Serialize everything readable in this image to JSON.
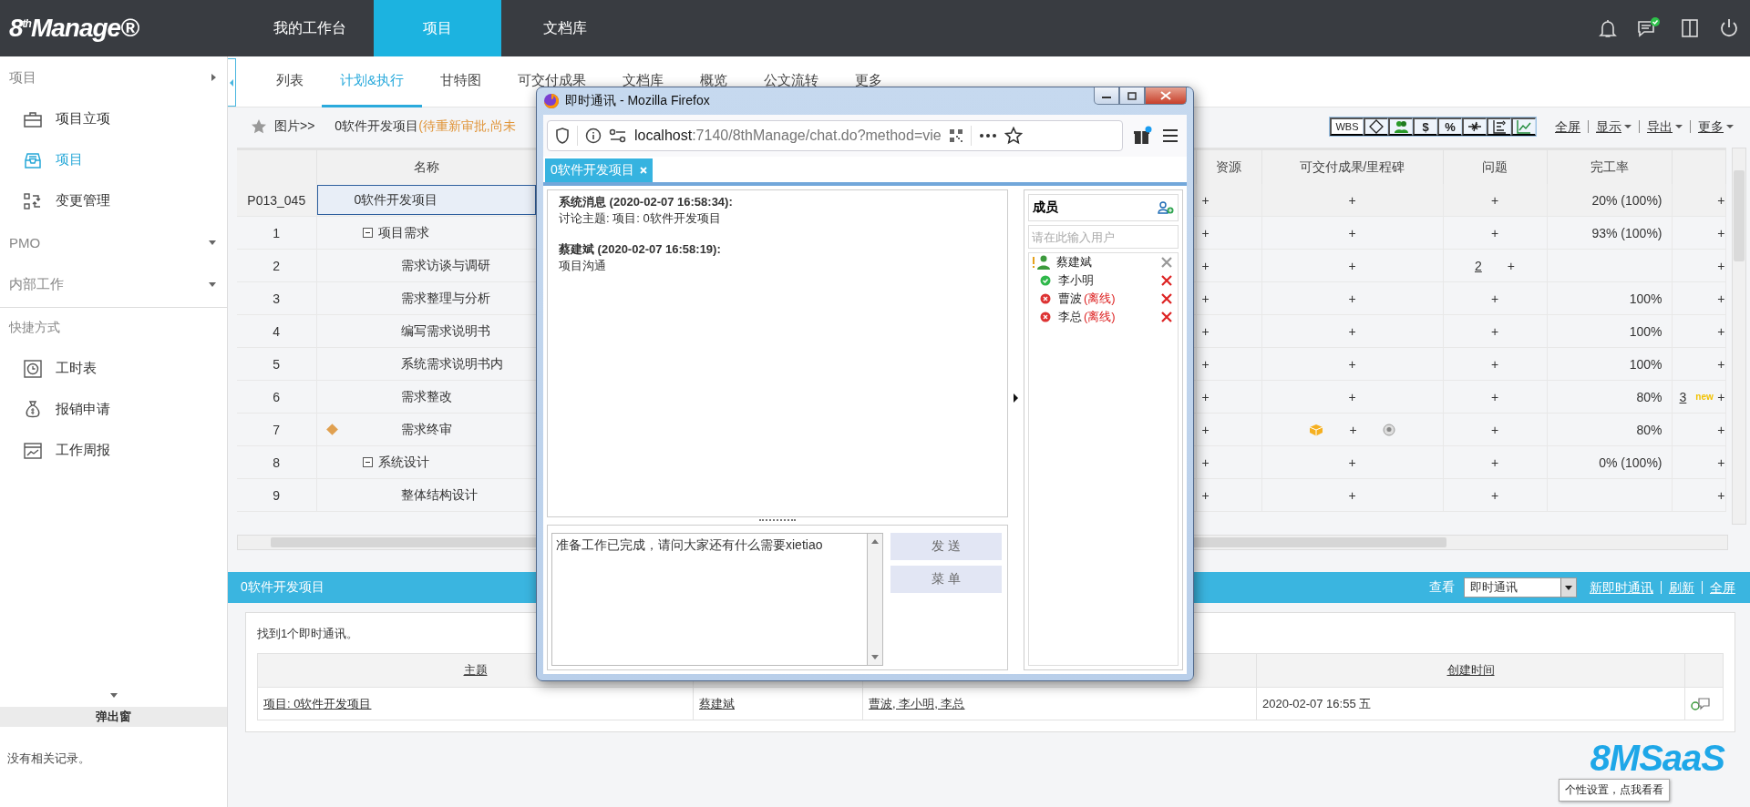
{
  "header": {
    "logo": "8$^{th}$Manage®",
    "nav": [
      {
        "label": "我的工作台",
        "selected": false
      },
      {
        "label": "项目",
        "selected": true
      },
      {
        "label": "文档库",
        "selected": false
      }
    ]
  },
  "sidebar": {
    "sections": [
      {
        "label": "项目",
        "expanded": true,
        "items": [
          {
            "label": "项目立项",
            "selected": false
          },
          {
            "label": "项目",
            "selected": true
          },
          {
            "label": "变更管理",
            "selected": false
          }
        ]
      },
      {
        "label": "PMO",
        "expanded": false
      },
      {
        "label": "内部工作",
        "expanded": false
      }
    ],
    "shortcuts": {
      "title": "快捷方式",
      "items": [
        "工时表",
        "报销申请",
        "工作周报"
      ]
    },
    "popup_panel": {
      "title": "弹出窗",
      "message": "没有相关记录。"
    }
  },
  "plan": {
    "tabs": [
      {
        "label": "列表",
        "selected": false
      },
      {
        "label": "计划&执行",
        "selected": true
      },
      {
        "label": "甘特图",
        "selected": false
      },
      {
        "label": "可交付成果",
        "selected": false
      },
      {
        "label": "文档库",
        "selected": false
      },
      {
        "label": "概览",
        "selected": false
      },
      {
        "label": "公文流转",
        "selected": false
      },
      {
        "label": "更多",
        "selected": false
      }
    ],
    "breadcrumb": {
      "link": "图片>>",
      "project": "0软件开发项目",
      "status": "(待重新审批,尚未"
    },
    "toolbar": {
      "buttons": [
        {
          "kind": "text",
          "label": "WBS",
          "selected": true
        },
        {
          "kind": "milestone",
          "selected": false
        },
        {
          "kind": "people",
          "selected": false
        },
        {
          "kind": "text",
          "label": "$",
          "selected": false
        },
        {
          "kind": "text",
          "label": "%",
          "selected": false
        },
        {
          "kind": "arrows",
          "selected": false
        },
        {
          "kind": "indent",
          "selected": false
        },
        {
          "kind": "chart",
          "selected": false
        }
      ],
      "links": [
        {
          "label": "全屏",
          "menu": false
        },
        {
          "label": "显示",
          "menu": true
        },
        {
          "label": "导出",
          "menu": true
        },
        {
          "label": "更多",
          "menu": true
        }
      ]
    },
    "table": {
      "columns": [
        "名称",
        "资源",
        "可交付成果/里程碑",
        "问题",
        "完工率"
      ],
      "rows": [
        {
          "id": "P013_045",
          "name": "0软件开发项目",
          "selected": true,
          "milestone": false,
          "resource": "+",
          "deliverable": "+",
          "deliverable_files": false,
          "issue_add": "+",
          "rate": "20% (100%)",
          "note_add": "+",
          "children": [
            {
              "id": "1",
              "name": "项目需求",
              "selected": false,
              "milestone": false,
              "expanded": true,
              "resource": "+",
              "deliverable": "+",
              "deliverable_files": false,
              "issue_add": "+",
              "rate": "93% (100%)",
              "note_add": "+",
              "children": [
                {
                  "id": "2",
                  "name": "需求访谈与调研",
                  "selected": false,
                  "milestone": false,
                  "resource": "+",
                  "deliverable": "+",
                  "deliverable_files": false,
                  "issues": "2",
                  "issue_add": "+",
                  "note_add": "+"
                },
                {
                  "id": "3",
                  "name": "需求整理与分析",
                  "selected": false,
                  "milestone": false,
                  "resource": "+",
                  "deliverable": "+",
                  "deliverable_files": false,
                  "issue_add": "+",
                  "rate": "100%",
                  "note_add": "+"
                },
                {
                  "id": "4",
                  "name": "编写需求说明书",
                  "selected": false,
                  "milestone": false,
                  "resource": "+",
                  "deliverable": "+",
                  "deliverable_files": false,
                  "issue_add": "+",
                  "rate": "100%",
                  "note_add": "+"
                },
                {
                  "id": "5",
                  "name": "系统需求说明书内",
                  "selected": false,
                  "milestone": false,
                  "resource": "+",
                  "deliverable": "+",
                  "deliverable_files": false,
                  "issue_add": "+",
                  "rate": "100%",
                  "note_add": "+"
                },
                {
                  "id": "6",
                  "name": "需求整改",
                  "selected": false,
                  "milestone": false,
                  "resource": "+",
                  "deliverable": "+",
                  "deliverable_files": false,
                  "issue_add": "+",
                  "rate": "80%",
                  "note_count": "3",
                  "note_badge": "new",
                  "note_add": "+"
                },
                {
                  "id": "7",
                  "name": "需求终审",
                  "selected": false,
                  "milestone": true,
                  "resource": "+",
                  "deliverable": "+",
                  "deliverable_files": true,
                  "issue_add": "+",
                  "rate": "80%",
                  "note_add": "+"
                }
              ]
            },
            {
              "id": "8",
              "name": "系统设计",
              "selected": false,
              "milestone": false,
              "expanded": true,
              "resource": "+",
              "deliverable": "+",
              "deliverable_files": false,
              "issue_add": "+",
              "rate": "0% (100%)",
              "note_add": "+",
              "children": [
                {
                  "id": "9",
                  "name": "整体结构设计",
                  "selected": false,
                  "milestone": false,
                  "resource": "+",
                  "deliverable": "+",
                  "deliverable_files": false,
                  "issue_add": "+",
                  "note_add": "+"
                }
              ]
            }
          ]
        }
      ]
    }
  },
  "chat_list": {
    "title": "0软件开发项目",
    "view_label": "查看",
    "view_value": "即时通讯",
    "links": [
      "新即时通讯",
      "刷新",
      "全屏"
    ],
    "summary": "找到1个即时通讯。",
    "columns": [
      {
        "label": "主题"
      },
      {},
      {},
      {
        "label": "创建时间"
      },
      {}
    ],
    "rows": [
      {
        "subject": "项目: 0软件开发项目",
        "creator": "蔡建斌",
        "members": "曹波, 李小明, 李总",
        "created": "2020-02-07 16:55 五"
      }
    ]
  },
  "popup": {
    "title": "即时通讯 - Mozilla Firefox",
    "url_host": "localhost",
    "url_path": ":7140/8thManage/chat.do?method=vie",
    "chat_tab": "0软件开发项目",
    "messages": [
      {
        "sender": "系统消息 (2020-02-07 16:58:34):",
        "text": "讨论主题: 项目: 0软件开发项目"
      },
      {
        "sender": "蔡建斌 (2020-02-07 16:58:19):",
        "text": "项目沟通"
      }
    ],
    "input_value": "准备工作已完成，请问大家还有什么需要xietiao",
    "buttons": [
      "发 送",
      "菜 单"
    ],
    "members_title": "成员",
    "member_search_placeholder": "请在此输入用户",
    "members": [
      {
        "name": "蔡建斌",
        "kind": "owner"
      },
      {
        "name": "李小明",
        "kind": "online"
      },
      {
        "name": "曹波",
        "kind": "offline",
        "status_text": "(离线)"
      },
      {
        "name": "李总",
        "kind": "offline",
        "status_text": "(离线)"
      }
    ]
  },
  "saas_logo": {
    "text": "8MSaaS",
    "tooltip": "个性设置，点我看看"
  }
}
